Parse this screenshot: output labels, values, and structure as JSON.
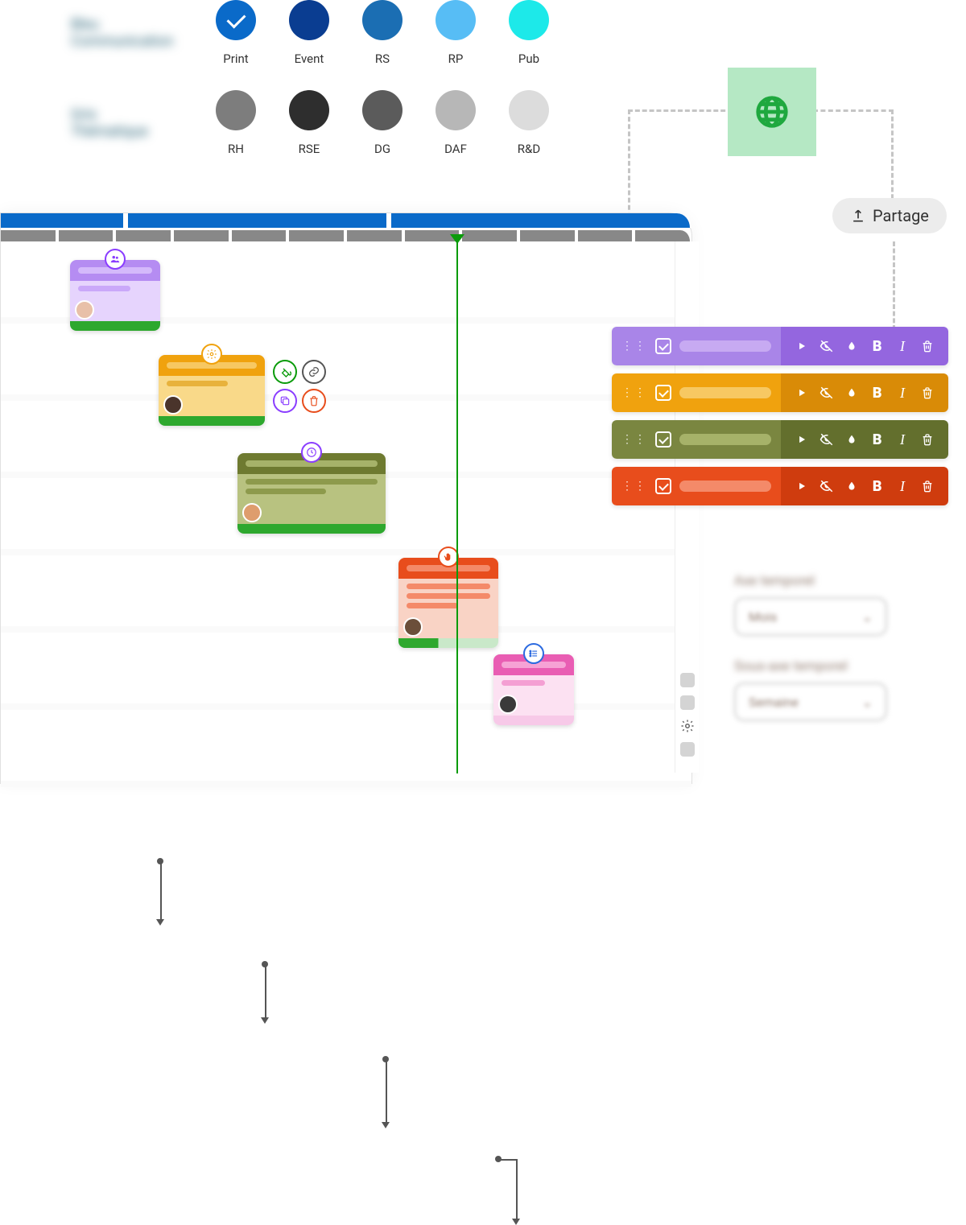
{
  "palette": {
    "row1": {
      "label_a": "Bleu",
      "label_b": "Communication",
      "items": [
        {
          "label": "Print",
          "color": "#0a6ac9",
          "checked": true
        },
        {
          "label": "Event",
          "color": "#0a3d91",
          "checked": false
        },
        {
          "label": "RS",
          "color": "#1b6eb3",
          "checked": false
        },
        {
          "label": "RP",
          "color": "#57bdf5",
          "checked": false
        },
        {
          "label": "Pub",
          "color": "#1de9e9",
          "checked": false
        }
      ]
    },
    "row2": {
      "label_a": "Gris",
      "label_b": "Thématique",
      "items": [
        {
          "label": "RH",
          "color": "#7d7d7d"
        },
        {
          "label": "RSE",
          "color": "#2e2e2e"
        },
        {
          "label": "DG",
          "color": "#5b5b5b"
        },
        {
          "label": "DAF",
          "color": "#b7b7b7"
        },
        {
          "label": "R&D",
          "color": "#dcdcdc"
        }
      ]
    }
  },
  "share_button_label": "Partage",
  "cards": {
    "c1": {
      "header": "#b58cf2",
      "header_line": "#d4b9fb",
      "body": "#e6d4fd",
      "line": "#caa8f9",
      "footer": "#2ea82e",
      "badge_border": "#8a3dff",
      "badge_icon": "people-icon",
      "avatar": "#e8c0a8"
    },
    "c2": {
      "header": "#f0a20e",
      "header_line": "#f7c862",
      "body": "#f9d989",
      "line": "#e8b23c",
      "footer": "#2ea82e",
      "badge_border": "#f0a20e",
      "badge_icon": "gear-icon",
      "avatar": "#4a342b"
    },
    "c3": {
      "header": "#6e7a30",
      "header_line": "#a6b269",
      "body": "#b8c280",
      "line": "#8d9a4c",
      "footer": "#2ea82e",
      "badge_border": "#8a3dff",
      "badge_icon": "clock-icon",
      "avatar": "#de9d6d"
    },
    "c4": {
      "header": "#e84d1c",
      "header_line": "#f48a69",
      "body": "#f9d3c5",
      "line": "#f48a69",
      "footer": "#2ea82e",
      "footer_partial": true,
      "badge_border": "#e84d1c",
      "badge_icon": "hand-icon",
      "avatar": "#6b4f3a"
    },
    "c5": {
      "header": "#e95db3",
      "header_line": "#f6a2d5",
      "body": "#fce1f2",
      "line": "#f49fd3",
      "footer": "#f7c9e8",
      "badge_border": "#2b6ae0",
      "badge_icon": "list-icon",
      "avatar": "#3a3a3a"
    }
  },
  "action_circles": [
    {
      "icon": "paint-bucket-icon",
      "border": "#0a9b0a",
      "color": "#0a9b0a"
    },
    {
      "icon": "link-chain-icon",
      "border": "#555",
      "color": "#555"
    },
    {
      "icon": "copy-icon",
      "border": "#8a3dff",
      "color": "#8a3dff"
    },
    {
      "icon": "trash-icon",
      "border": "#e84d1c",
      "color": "#e84d1c"
    }
  ],
  "legend_rows": [
    {
      "left": "#a985e8",
      "pill": "#c7aaf2",
      "right": "#9466df"
    },
    {
      "left": "#f0a20e",
      "pill": "#f7c862",
      "right": "#d98b07"
    },
    {
      "left": "#7a8640",
      "pill": "#a6b269",
      "right": "#636f2d"
    },
    {
      "left": "#e84d1c",
      "pill": "#f48a69",
      "right": "#cf3c0e"
    }
  ],
  "legend_tools": [
    "play-icon",
    "eye-slash-icon",
    "drop-icon",
    "bold-icon",
    "italic-icon",
    "trash-icon"
  ],
  "settings": {
    "label1": "Axe temporel",
    "select1": "Mois",
    "label2": "Sous-axe temporel",
    "select2": "Semaine"
  }
}
